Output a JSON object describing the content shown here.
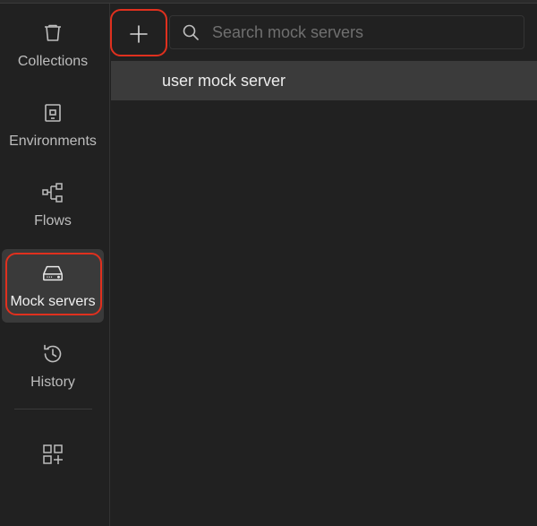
{
  "sidebar": {
    "items": [
      {
        "label": "Collections",
        "icon": "trash-icon"
      },
      {
        "label": "Environments",
        "icon": "environment-icon"
      },
      {
        "label": "Flows",
        "icon": "flows-icon"
      },
      {
        "label": "Mock servers",
        "icon": "server-icon",
        "active": true
      },
      {
        "label": "History",
        "icon": "history-icon"
      }
    ],
    "extra_icon": "add-widget-icon"
  },
  "toolbar": {
    "add_icon": "plus-icon"
  },
  "search": {
    "placeholder": "Search mock servers",
    "value": ""
  },
  "mock_servers": [
    {
      "name": "user mock server"
    }
  ],
  "colors": {
    "highlight": "#e0301e",
    "active_bg": "#3a3a3a",
    "background": "#212121"
  }
}
